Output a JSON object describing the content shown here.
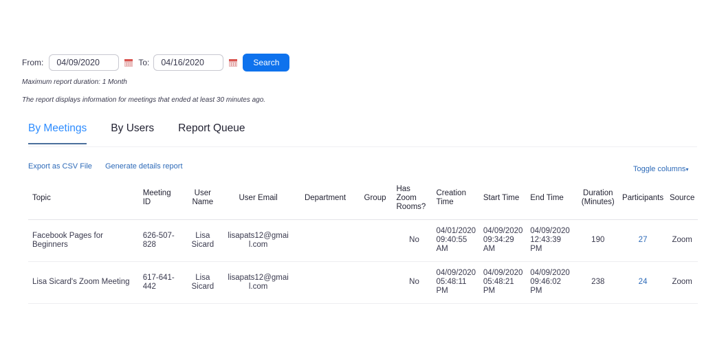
{
  "filters": {
    "from_label": "From:",
    "from_value": "04/09/2020",
    "to_label": "To:",
    "to_value": "04/16/2020",
    "search_label": "Search",
    "calendar_icon": "calendar-icon"
  },
  "notes": {
    "max_duration": "Maximum report duration: 1 Month",
    "info": "The report displays information for meetings that ended at least 30 minutes ago."
  },
  "tabs": [
    {
      "label": "By Meetings",
      "active": true
    },
    {
      "label": "By Users",
      "active": false
    },
    {
      "label": "Report Queue",
      "active": false
    }
  ],
  "actions": {
    "export_csv": "Export as CSV File",
    "generate_details": "Generate details report",
    "toggle_columns": "Toggle columns",
    "toggle_caret": "▾"
  },
  "colors": {
    "accent": "#2d8cff",
    "button": "#0e72ed",
    "link": "#2d6ab8"
  },
  "table": {
    "headers": {
      "topic": "Topic",
      "meeting_id": [
        "Meeting",
        "ID"
      ],
      "user_name": [
        "User",
        "Name"
      ],
      "user_email": "User Email",
      "department": "Department",
      "group": "Group",
      "has_zoom_rooms": [
        "Has",
        "Zoom",
        "Rooms?"
      ],
      "creation_time": [
        "Creation",
        "Time"
      ],
      "start_time": "Start Time",
      "end_time": "End Time",
      "duration": [
        "Duration",
        "(Minutes)"
      ],
      "participants": "Participants",
      "source": "Source"
    },
    "rows": [
      {
        "topic": "Facebook Pages for Beginners",
        "meeting_id": [
          "626-507-",
          "828"
        ],
        "user_name": [
          "Lisa",
          "Sicard"
        ],
        "user_email": [
          "lisapats12@gmai",
          "l.com"
        ],
        "department": "",
        "group": "",
        "has_zoom_rooms": "No",
        "creation_time": [
          "04/01/2020",
          "09:40:55",
          "AM"
        ],
        "start_time": [
          "04/09/2020",
          "09:34:29",
          "AM"
        ],
        "end_time": [
          "04/09/2020",
          "12:43:39",
          "PM"
        ],
        "duration": "190",
        "participants": "27",
        "source": "Zoom"
      },
      {
        "topic": "Lisa Sicard's Zoom Meeting",
        "meeting_id": [
          "617-641-",
          "442"
        ],
        "user_name": [
          "Lisa",
          "Sicard"
        ],
        "user_email": [
          "lisapats12@gmai",
          "l.com"
        ],
        "department": "",
        "group": "",
        "has_zoom_rooms": "No",
        "creation_time": [
          "04/09/2020",
          "05:48:11",
          "PM"
        ],
        "start_time": [
          "04/09/2020",
          "05:48:21",
          "PM"
        ],
        "end_time": [
          "04/09/2020",
          "09:46:02",
          "PM"
        ],
        "duration": "238",
        "participants": "24",
        "source": "Zoom"
      }
    ]
  }
}
